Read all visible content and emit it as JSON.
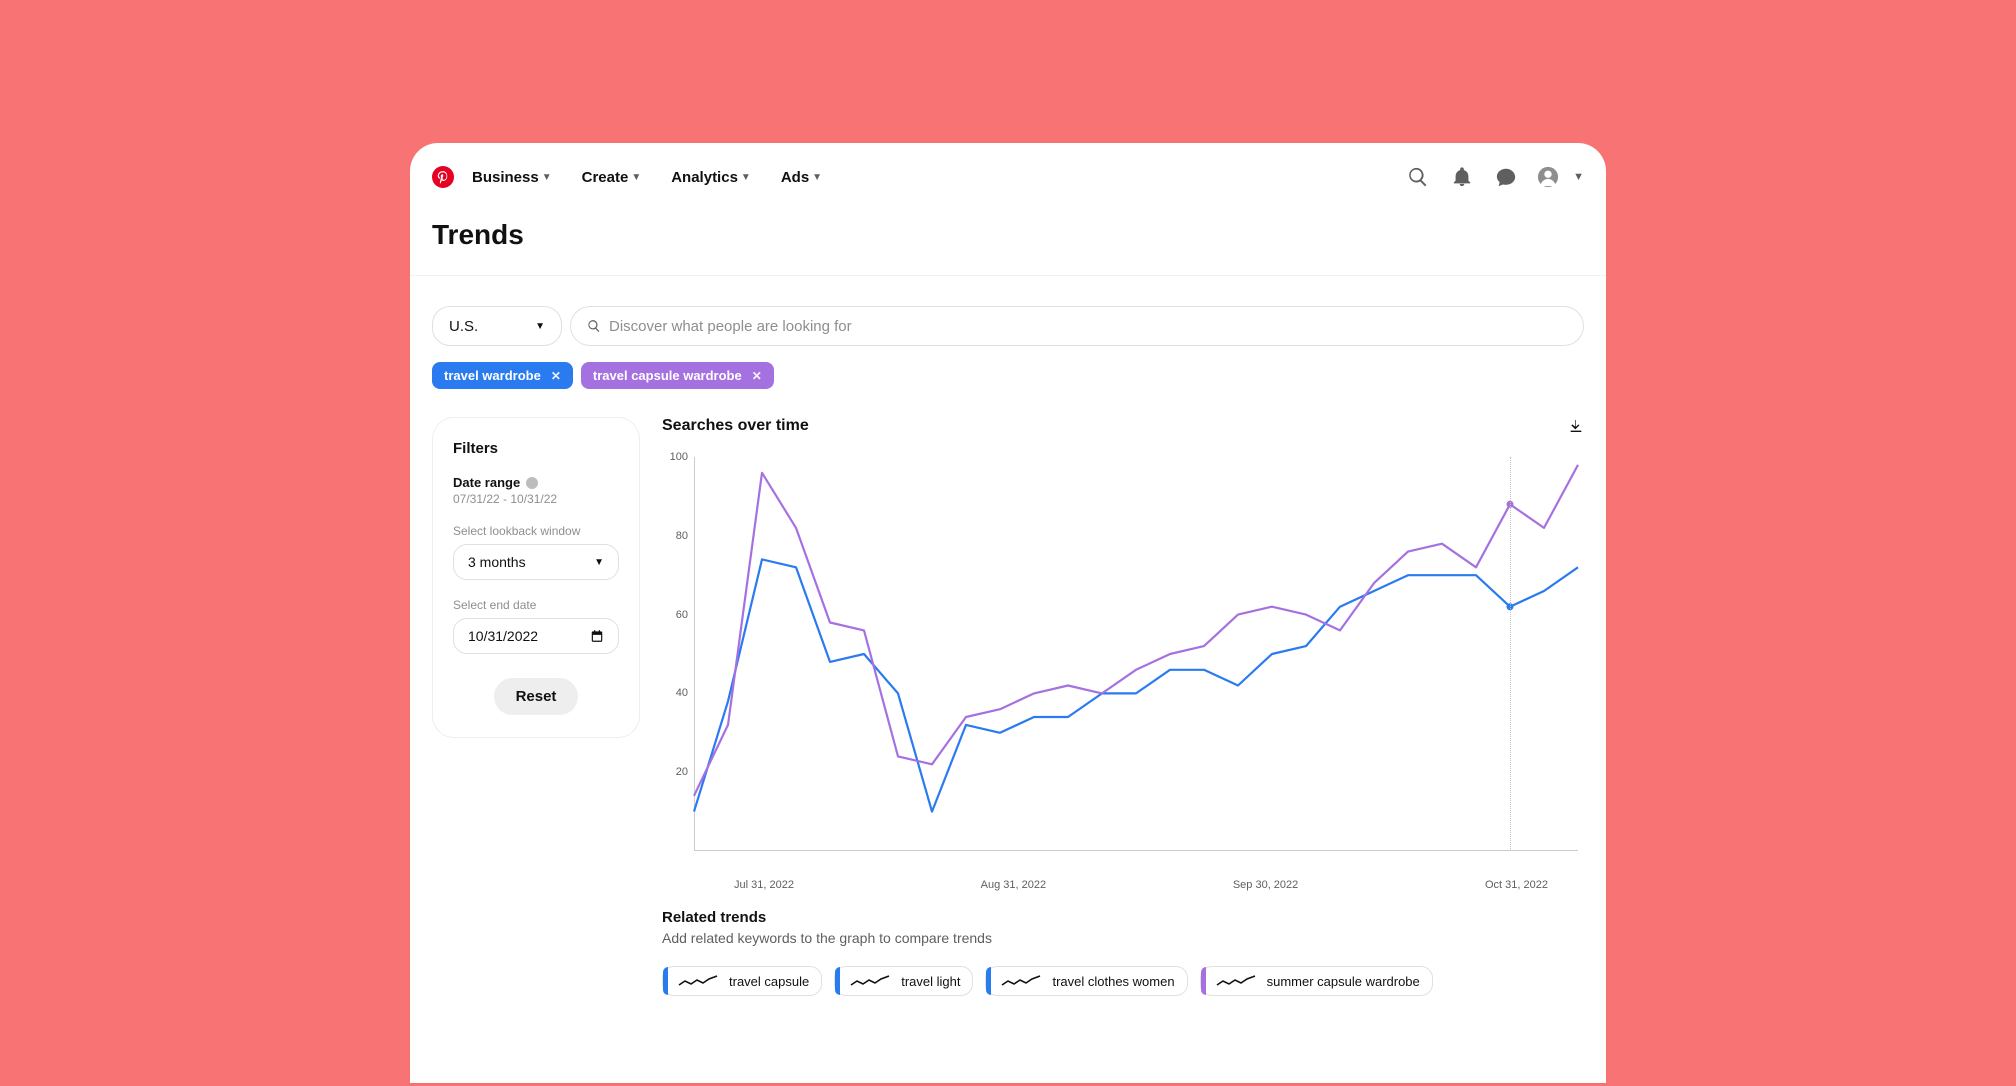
{
  "nav": {
    "items": [
      {
        "label": "Business"
      },
      {
        "label": "Create"
      },
      {
        "label": "Analytics"
      },
      {
        "label": "Ads"
      }
    ]
  },
  "page": {
    "title": "Trends"
  },
  "region": {
    "label": "U.S."
  },
  "search": {
    "placeholder": "Discover what people are looking for"
  },
  "chips": [
    {
      "label": "travel wardrobe",
      "color": "#2a7af0"
    },
    {
      "label": "travel capsule wardrobe",
      "color": "#a571e0"
    }
  ],
  "filters": {
    "title": "Filters",
    "dateRangeLabel": "Date range",
    "dateRangeValue": "07/31/22 - 10/31/22",
    "lookbackLabel": "Select lookback window",
    "lookbackValue": "3 months",
    "endDateLabel": "Select end date",
    "endDateValue": "10/31/2022",
    "resetLabel": "Reset"
  },
  "chart": {
    "title": "Searches over time"
  },
  "related": {
    "title": "Related trends",
    "subtitle": "Add related keywords to the graph to compare trends",
    "items": [
      {
        "label": "travel capsule",
        "color": "#2a7af0"
      },
      {
        "label": "travel light",
        "color": "#2a7af0"
      },
      {
        "label": "travel clothes women",
        "color": "#2a7af0"
      },
      {
        "label": "summer capsule wardrobe",
        "color": "#a571e0"
      }
    ]
  },
  "chart_data": {
    "type": "line",
    "title": "Searches over time",
    "ylabel": "",
    "xlabel": "",
    "ylim": [
      0,
      100
    ],
    "y_ticks": [
      20,
      40,
      60,
      80,
      100
    ],
    "x_ticks": [
      "Jul 31, 2022",
      "Aug 31, 2022",
      "Sep 30, 2022",
      "Oct 31, 2022"
    ],
    "x_index": [
      0,
      1,
      2,
      3,
      4,
      5,
      6,
      7,
      8,
      9,
      10,
      11,
      12,
      13,
      14,
      15,
      16,
      17,
      18,
      19,
      20,
      21,
      22,
      23,
      24,
      25,
      26
    ],
    "marker_index": 24,
    "series": [
      {
        "name": "travel wardrobe",
        "color": "#2a7af0",
        "values": [
          10,
          38,
          74,
          72,
          48,
          50,
          40,
          10,
          32,
          30,
          34,
          34,
          40,
          40,
          46,
          46,
          42,
          50,
          52,
          62,
          66,
          70,
          70,
          70,
          62,
          66,
          72
        ],
        "marker_value": 62
      },
      {
        "name": "travel capsule wardrobe",
        "color": "#a571e0",
        "values": [
          14,
          32,
          96,
          82,
          58,
          56,
          24,
          22,
          34,
          36,
          40,
          42,
          40,
          46,
          50,
          52,
          60,
          62,
          60,
          56,
          68,
          76,
          78,
          72,
          88,
          82,
          98
        ],
        "marker_value": 88
      }
    ]
  }
}
